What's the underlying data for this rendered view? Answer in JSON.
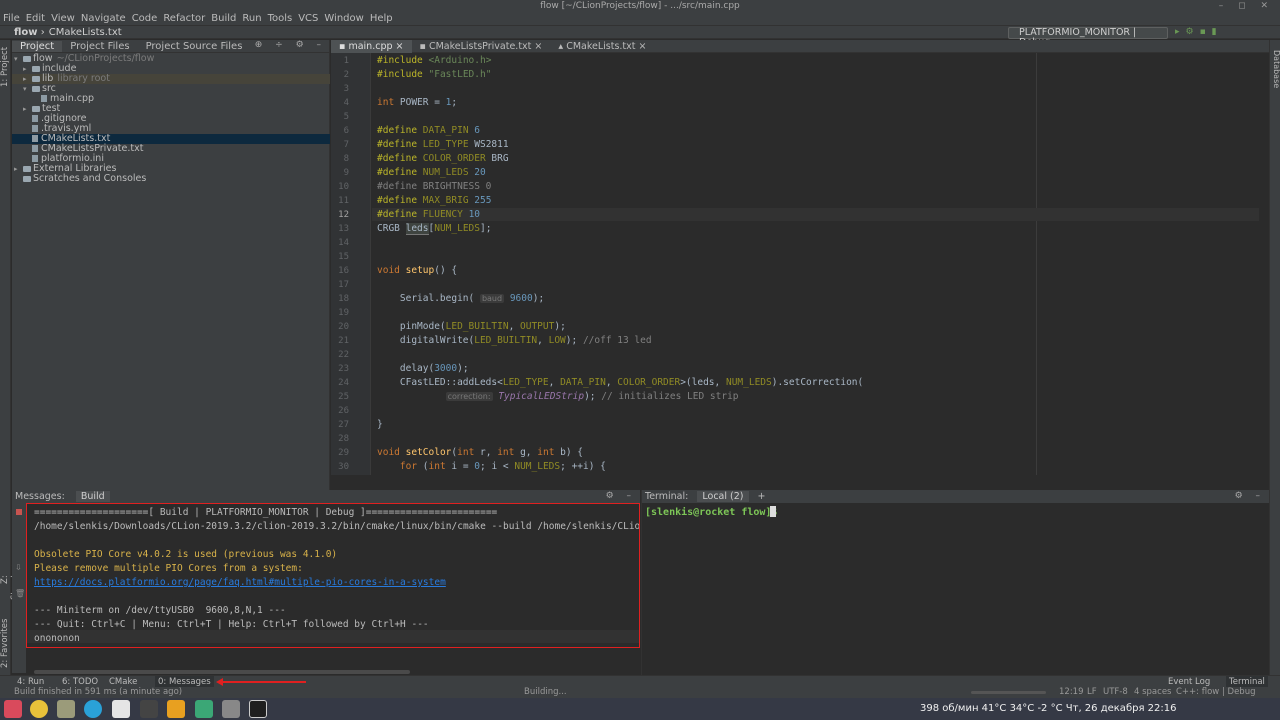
{
  "window": {
    "title": "flow [~/CLionProjects/flow] - .../src/main.cpp",
    "controls": "– ◻ ✕"
  },
  "menu": [
    "File",
    "Edit",
    "View",
    "Navigate",
    "Code",
    "Refactor",
    "Build",
    "Run",
    "Tools",
    "VCS",
    "Window",
    "Help"
  ],
  "nav": {
    "project": "flow",
    "file": "CMakeLists.txt",
    "run_config": "PLATFORMIO_MONITOR | Debug"
  },
  "left_strip": {
    "project": "1: Project",
    "structure": "Z: Structure",
    "favorites": "2: Favorites"
  },
  "right_strip": {
    "database": "Database"
  },
  "project_panel": {
    "tabs": [
      "Project",
      "Project Files",
      "Project Source Files"
    ],
    "tree": [
      {
        "name": "flow",
        "extra": "~/CLionProjects/flow",
        "indent": 0,
        "arrow": "▾",
        "type": "folder"
      },
      {
        "name": "include",
        "extra": "",
        "indent": 1,
        "arrow": "▸",
        "type": "folder"
      },
      {
        "name": "lib",
        "extra": "library root",
        "indent": 1,
        "arrow": "▸",
        "type": "folder"
      },
      {
        "name": "src",
        "extra": "",
        "indent": 1,
        "arrow": "▾",
        "type": "folder"
      },
      {
        "name": "main.cpp",
        "extra": "",
        "indent": 2,
        "arrow": "",
        "type": "file"
      },
      {
        "name": "test",
        "extra": "",
        "indent": 1,
        "arrow": "▸",
        "type": "folder"
      },
      {
        "name": ".gitignore",
        "extra": "",
        "indent": 1,
        "arrow": "",
        "type": "file"
      },
      {
        "name": ".travis.yml",
        "extra": "",
        "indent": 1,
        "arrow": "",
        "type": "file"
      },
      {
        "name": "CMakeLists.txt",
        "extra": "",
        "indent": 1,
        "arrow": "",
        "type": "file"
      },
      {
        "name": "CMakeListsPrivate.txt",
        "extra": "",
        "indent": 1,
        "arrow": "",
        "type": "file"
      },
      {
        "name": "platformio.ini",
        "extra": "",
        "indent": 1,
        "arrow": "",
        "type": "file"
      },
      {
        "name": "External Libraries",
        "extra": "",
        "indent": 0,
        "arrow": "▸",
        "type": "folder"
      },
      {
        "name": "Scratches and Consoles",
        "extra": "",
        "indent": 0,
        "arrow": "",
        "type": "folder"
      }
    ]
  },
  "editor_tabs": [
    "main.cpp",
    "CMakeListsPrivate.txt",
    "CMakeLists.txt"
  ],
  "code_lines": [
    "1",
    "2",
    "3",
    "4",
    "5",
    "6",
    "7",
    "8",
    "9",
    "10",
    "11",
    "12",
    "13",
    "14",
    "15",
    "16",
    "17",
    "18",
    "19",
    "20",
    "21",
    "22",
    "23",
    "24",
    "25",
    "26",
    "27",
    "28",
    "29",
    "30"
  ],
  "messages": {
    "label": "Messages:",
    "tab": "Build",
    "lines": [
      "====================[ Build | PLATFORMIO_MONITOR | Debug ]=======================",
      "/home/slenkis/Downloads/CLion-2019.3.2/clion-2019.3.2/bin/cmake/linux/bin/cmake --build /home/slenkis/CLionPro",
      "",
      "Obsolete PIO Core v4.0.2 is used (previous was 4.1.0)",
      "Please remove multiple PIO Cores from a system:",
      "https://docs.platformio.org/page/faq.html#multiple-pio-cores-in-a-system",
      "",
      "--- Miniterm on /dev/ttyUSB0  9600,8,N,1 ---",
      "--- Quit: Ctrl+C | Menu: Ctrl+T | Help: Ctrl+T followed by Ctrl+H ---",
      "оnononon"
    ]
  },
  "terminal": {
    "label": "Terminal:",
    "tab": "Local (2)",
    "add": "+",
    "prompt": "[slenkis@rocket flow]$"
  },
  "tool_windows": [
    "4: Run",
    "6: TODO",
    "CMake",
    "0: Messages"
  ],
  "tool_windows_right": [
    "Event Log",
    "Terminal"
  ],
  "status": {
    "left": "Build finished in 591 ms (a minute ago)",
    "center": "Building...",
    "position": "12:19",
    "line_sep": "LF",
    "encoding": "UTF-8",
    "indent": "4 spaces",
    "context": "C++: flow | Debug"
  },
  "taskbar": {
    "tray": "398 об/мин  41°C  34°C  -2 °C  Чт, 26 декабря  22:16"
  },
  "colors": {
    "accent_red": "#e02020",
    "selection": "#0d293e",
    "keyword": "#cc7832"
  }
}
